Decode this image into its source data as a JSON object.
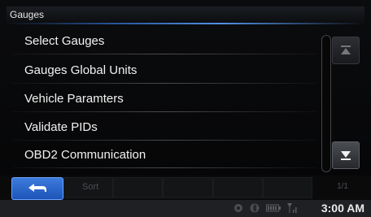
{
  "header": {
    "title": "Gauges"
  },
  "menu": {
    "items": [
      {
        "label": "Select Gauges"
      },
      {
        "label": "Gauges Global Units"
      },
      {
        "label": "Vehicle Paramters"
      },
      {
        "label": "Validate PIDs"
      },
      {
        "label": "OBD2 Communication"
      }
    ]
  },
  "bottom_bar": {
    "sort_label": "Sort",
    "page_count": "1/1"
  },
  "status_bar": {
    "time": "3:00 AM",
    "icons": [
      "gps-icon",
      "bluetooth-icon",
      "battery-icon",
      "signal-icon"
    ]
  },
  "colors": {
    "accent": "#2a5ca8",
    "back_button": "#1d54b8"
  }
}
